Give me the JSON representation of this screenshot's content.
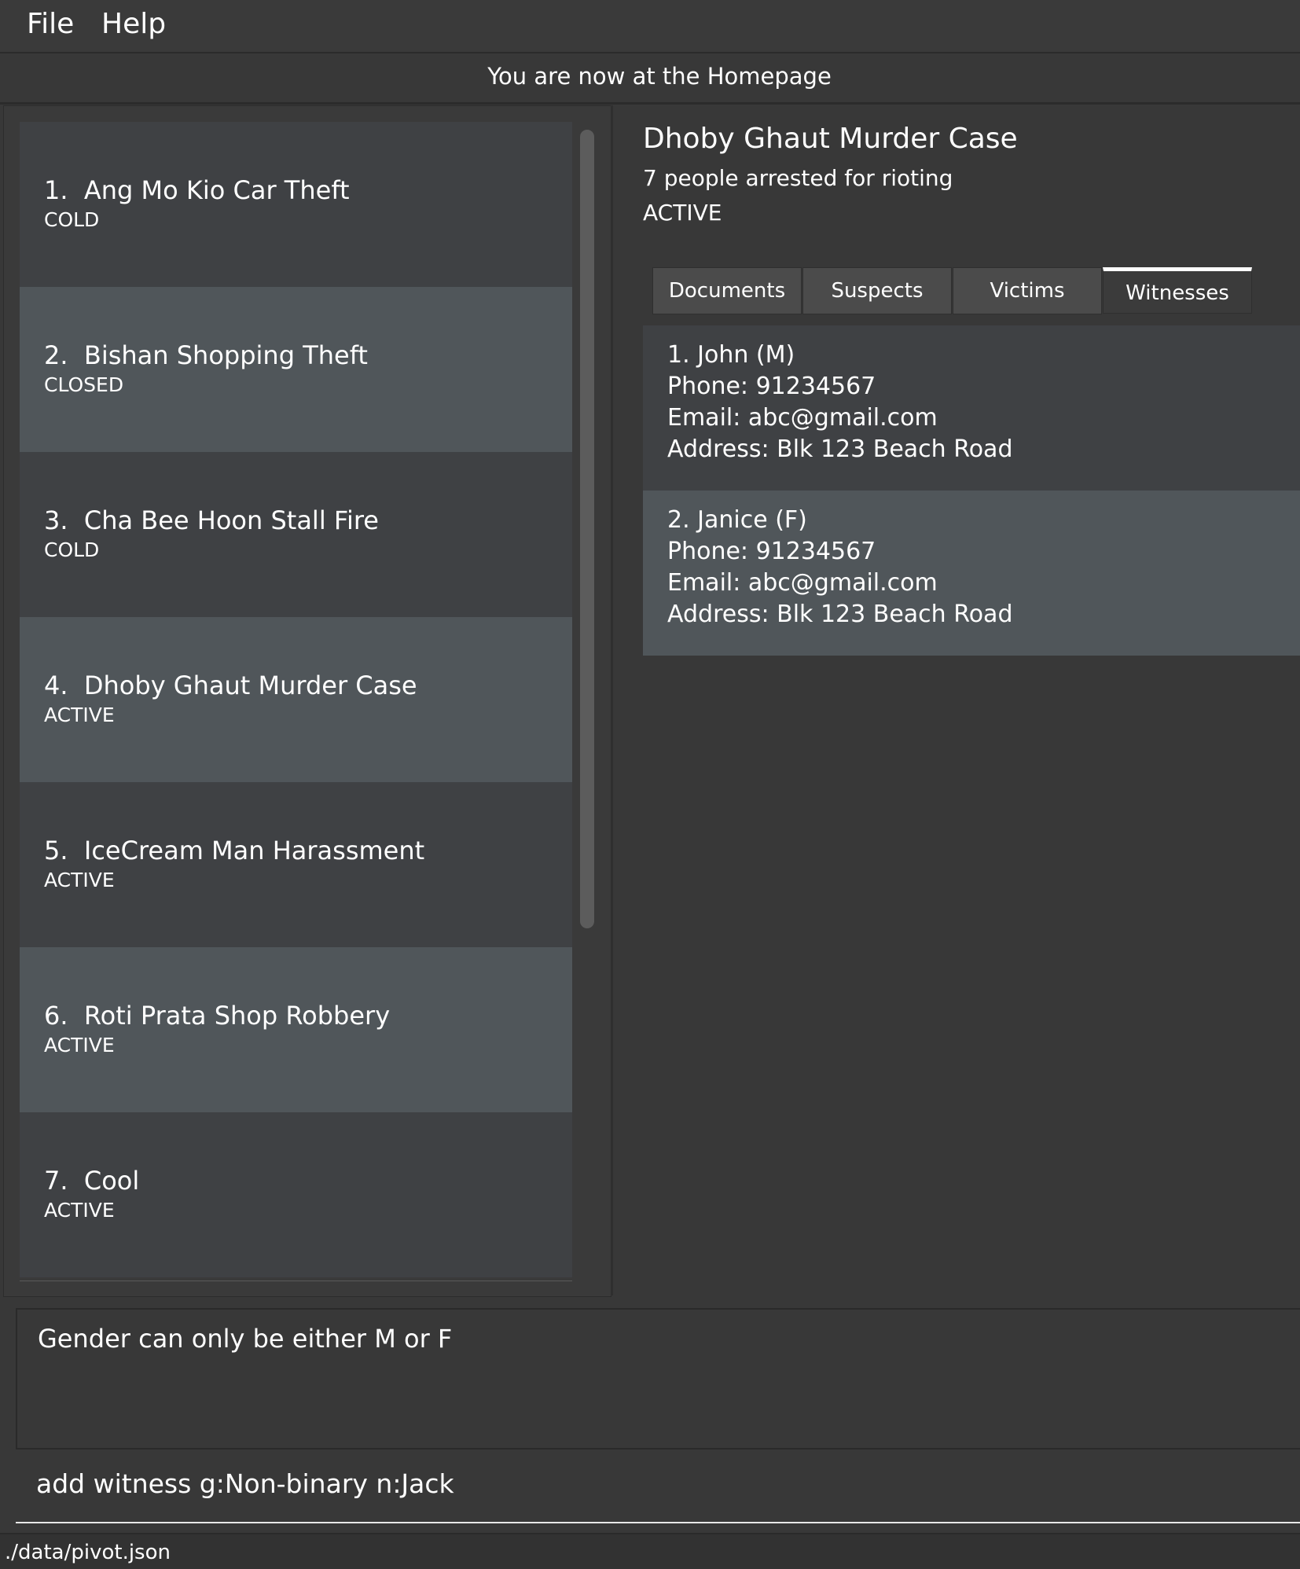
{
  "menu": {
    "file": "File",
    "help": "Help"
  },
  "status_message": "You are now at the Homepage",
  "cases": [
    {
      "index": "1.",
      "title": "Ang Mo Kio Car Theft",
      "status": "COLD"
    },
    {
      "index": "2.",
      "title": "Bishan Shopping Theft",
      "status": "CLOSED"
    },
    {
      "index": "3.",
      "title": "Cha Bee Hoon Stall Fire",
      "status": "COLD"
    },
    {
      "index": "4.",
      "title": "Dhoby Ghaut Murder Case",
      "status": "ACTIVE"
    },
    {
      "index": "5.",
      "title": "IceCream Man Harassment",
      "status": "ACTIVE"
    },
    {
      "index": "6.",
      "title": "Roti Prata Shop Robbery",
      "status": "ACTIVE"
    },
    {
      "index": "7.",
      "title": "Cool",
      "status": "ACTIVE"
    }
  ],
  "detail": {
    "title": "Dhoby Ghaut Murder Case",
    "description": "7 people arrested for rioting",
    "status": "ACTIVE",
    "tabs": [
      "Documents",
      "Suspects",
      "Victims",
      "Witnesses"
    ],
    "selected_tab": "Witnesses",
    "witnesses": [
      {
        "header": "1.  John (M)",
        "phone": "Phone: 91234567",
        "email": "Email: abc@gmail.com",
        "address": "Address: Blk 123 Beach Road"
      },
      {
        "header": "2.  Janice (F)",
        "phone": "Phone: 91234567",
        "email": "Email: abc@gmail.com",
        "address": "Address: Blk 123 Beach Road"
      }
    ]
  },
  "result_message": "Gender can only be either M or F",
  "command_input": "add witness g:Non-binary n:Jack",
  "footer_path": "./data/pivot.json"
}
